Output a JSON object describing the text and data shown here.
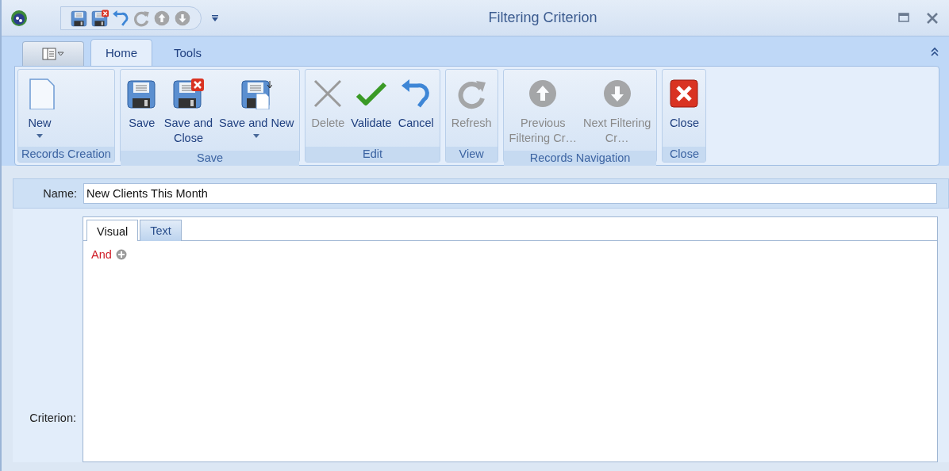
{
  "window": {
    "title": "Filtering Criterion"
  },
  "quick_access": [
    {
      "kind": "save",
      "disabled": false
    },
    {
      "kind": "save-close",
      "disabled": false
    },
    {
      "kind": "undo",
      "disabled": false
    },
    {
      "kind": "refresh",
      "disabled": true
    },
    {
      "kind": "up",
      "disabled": true
    },
    {
      "kind": "down",
      "disabled": true
    }
  ],
  "ribbon_tabs": [
    {
      "label": "Home",
      "selected": true
    },
    {
      "label": "Tools",
      "selected": false
    }
  ],
  "ribbon_groups": [
    {
      "caption": "Records Creation",
      "buttons": [
        {
          "label": "New",
          "kind": "new",
          "disabled": false,
          "dropdown": true
        }
      ]
    },
    {
      "caption": "Save",
      "buttons": [
        {
          "label": "Save",
          "kind": "save",
          "disabled": false,
          "dropdown": false
        },
        {
          "label": "Save and\nClose",
          "kind": "save-close",
          "disabled": false,
          "dropdown": false
        },
        {
          "label": "Save and New",
          "kind": "save-new",
          "disabled": false,
          "dropdown": true
        }
      ]
    },
    {
      "caption": "Edit",
      "buttons": [
        {
          "label": "Delete",
          "kind": "delete",
          "disabled": true,
          "dropdown": false
        },
        {
          "label": "Validate",
          "kind": "validate",
          "disabled": false,
          "dropdown": false
        },
        {
          "label": "Cancel",
          "kind": "undo",
          "disabled": false,
          "dropdown": false
        }
      ]
    },
    {
      "caption": "View",
      "buttons": [
        {
          "label": "Refresh",
          "kind": "refresh",
          "disabled": true,
          "dropdown": false
        }
      ]
    },
    {
      "caption": "Records Navigation",
      "buttons": [
        {
          "label": "Previous\nFiltering Cr…",
          "kind": "up",
          "disabled": true,
          "dropdown": false
        },
        {
          "label": "Next Filtering\nCr…",
          "kind": "down",
          "disabled": true,
          "dropdown": false
        }
      ]
    },
    {
      "caption": "Close",
      "buttons": [
        {
          "label": "Close",
          "kind": "close",
          "disabled": false,
          "dropdown": false
        }
      ]
    }
  ],
  "name_field": {
    "label": "Name:",
    "value": "New Clients This Month"
  },
  "criterion": {
    "label": "Criterion:",
    "tabs": [
      {
        "label": "Visual",
        "selected": true
      },
      {
        "label": "Text",
        "selected": false
      }
    ],
    "root_operator": "And"
  }
}
